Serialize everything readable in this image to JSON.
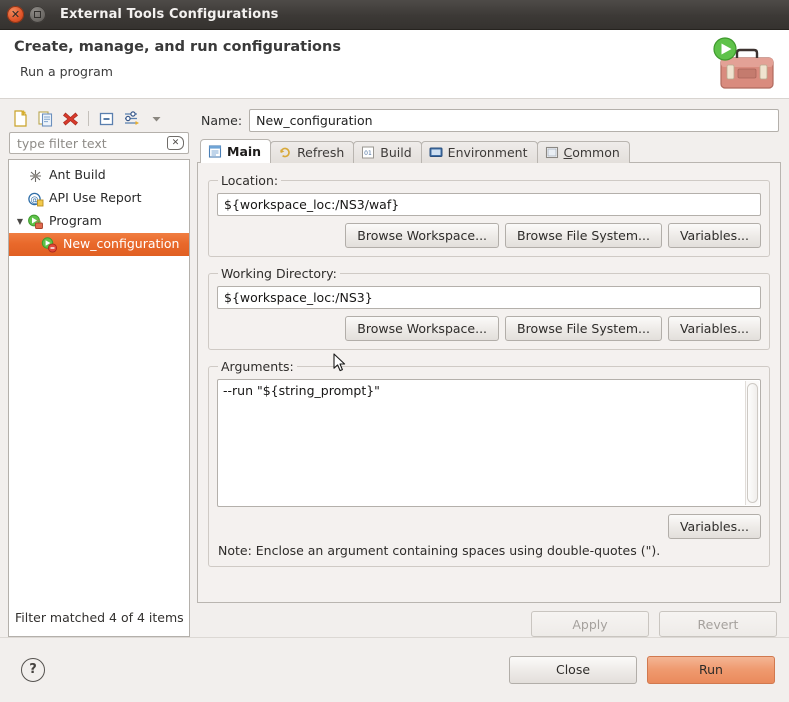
{
  "window": {
    "title": "External Tools Configurations",
    "close_button": "close-button",
    "maximize_button": "maximize-button"
  },
  "banner": {
    "title": "Create, manage, and run configurations",
    "subtitle": "Run a program",
    "icon": "toolbox-run-icon"
  },
  "tree_toolbar": {
    "icons": [
      {
        "name": "new-configuration-icon",
        "label": "New launch configuration"
      },
      {
        "name": "duplicate-configuration-icon",
        "label": "Duplicate"
      },
      {
        "name": "delete-configuration-icon",
        "label": "Delete"
      },
      {
        "name": "collapse-all-icon",
        "label": "Collapse All"
      },
      {
        "name": "filter-icon",
        "label": "Filter launch configurations"
      },
      {
        "name": "view-menu-chevron-down-icon",
        "label": "View Menu"
      }
    ]
  },
  "filter": {
    "placeholder": "type filter text",
    "value": "",
    "clear_icon": "clear-icon",
    "status": "Filter matched 4 of 4 items"
  },
  "tree": {
    "items": [
      {
        "label": "Ant Build",
        "icon": "ant-build-icon",
        "depth": 0,
        "expandable": false,
        "selected": false
      },
      {
        "label": "API Use Report",
        "icon": "api-use-report-icon",
        "depth": 0,
        "expandable": false,
        "selected": false
      },
      {
        "label": "Program",
        "icon": "program-icon",
        "depth": 0,
        "expandable": true,
        "expanded": true,
        "selected": false
      },
      {
        "label": "New_configuration",
        "icon": "program-config-icon",
        "depth": 1,
        "expandable": false,
        "selected": true
      }
    ]
  },
  "config": {
    "name_label": "Name:",
    "name_value": "New_configuration",
    "tabs": [
      {
        "label": "Main",
        "icon": "main-tab-icon",
        "active": true,
        "mnemonic": ""
      },
      {
        "label": "Refresh",
        "icon": "refresh-tab-icon",
        "active": false,
        "mnemonic": ""
      },
      {
        "label": "Build",
        "icon": "build-tab-icon",
        "active": false,
        "mnemonic": ""
      },
      {
        "label": "Environment",
        "icon": "environment-tab-icon",
        "active": false,
        "mnemonic": ""
      },
      {
        "label": "Common",
        "icon": "common-tab-icon",
        "active": false,
        "mnemonic": "C"
      }
    ],
    "location": {
      "legend": "Location:",
      "value": "${workspace_loc:/NS3/waf}",
      "buttons": [
        "Browse Workspace...",
        "Browse File System...",
        "Variables..."
      ]
    },
    "working_directory": {
      "legend": "Working Directory:",
      "value": "${workspace_loc:/NS3}",
      "buttons": [
        "Browse Workspace...",
        "Browse File System...",
        "Variables..."
      ]
    },
    "arguments": {
      "legend": "Arguments:",
      "value": "--run \"${string_prompt}\"",
      "variables_button": "Variables...",
      "note": "Note: Enclose an argument containing spaces using double-quotes (\")."
    },
    "apply_label": "Apply",
    "revert_label": "Revert"
  },
  "footer": {
    "help_icon": "help-icon",
    "help_glyph": "?",
    "close_label": "Close",
    "run_label": "Run"
  },
  "colors": {
    "selection_orange": "#e9692b",
    "run_button_orange": "#ef9a6f",
    "titlebar_dark": "#3c3936",
    "close_button_red": "#e2562a"
  }
}
